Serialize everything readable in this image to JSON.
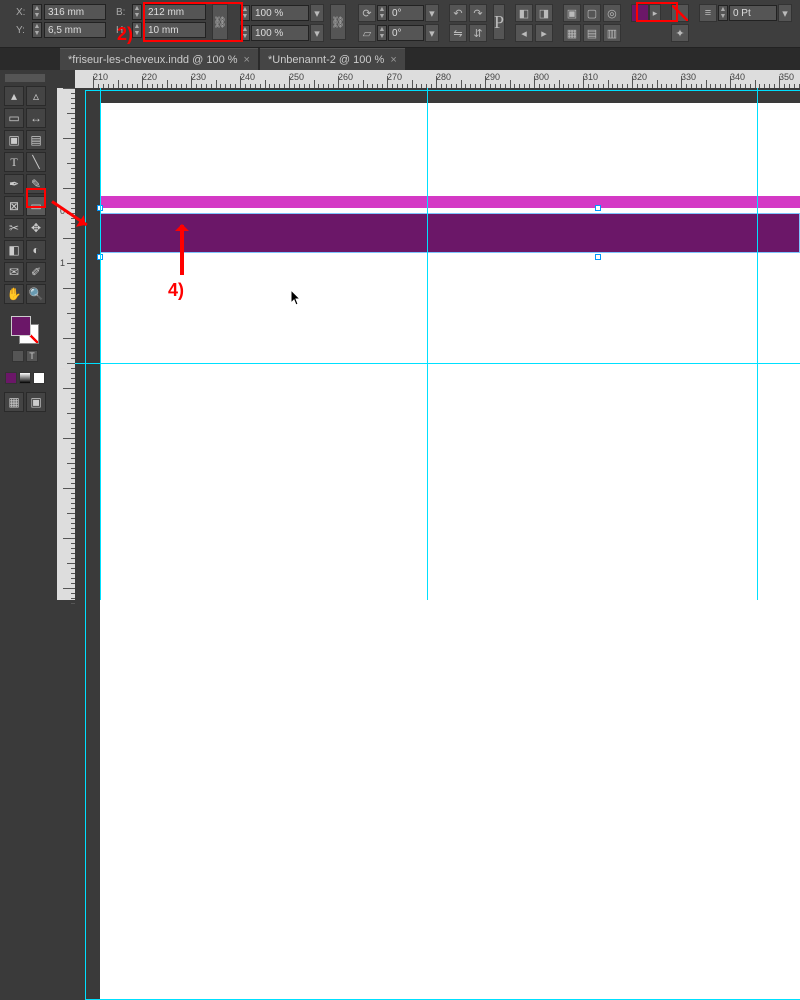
{
  "controlbar": {
    "x_label": "X:",
    "x_value": "316 mm",
    "y_label": "Y:",
    "y_value": "6,5 mm",
    "w_label": "B:",
    "w_value": "212 mm",
    "h_label": "H:",
    "h_value": "10 mm",
    "scale_x": "100 %",
    "scale_y": "100 %",
    "rotate": "0°",
    "shear": "0°",
    "stroke_weight": "0 Pt",
    "fill_color": "#6b1768"
  },
  "tabs": [
    {
      "label": "*friseur-les-cheveux.indd @ 100 %"
    },
    {
      "label": "*Unbenannt-2 @ 100 %"
    }
  ],
  "ruler_h": [
    "210",
    "220",
    "230",
    "240",
    "250",
    "260",
    "270",
    "280",
    "290",
    "300",
    "310",
    "320",
    "330",
    "340",
    "350"
  ],
  "ruler_v": [
    "0",
    "1"
  ],
  "annotations": {
    "two": "2)",
    "four": "4)"
  },
  "tool_names": {
    "selection": "selection-tool",
    "direct": "direct-select-tool",
    "page": "page-tool",
    "gap": "gap-tool",
    "content": "content-collector-tool",
    "place": "content-placer-tool",
    "type": "type-tool",
    "line": "line-tool",
    "pen": "pen-tool",
    "pencil": "pencil-tool",
    "rect-frame": "rectangle-frame-tool",
    "rect": "rectangle-tool",
    "scissors": "scissors-tool",
    "transform": "free-transform-tool",
    "gradient-swatch": "gradient-swatch-tool",
    "gradient-feather": "gradient-feather-tool",
    "note": "note-tool",
    "eyedropper": "eyedropper-tool",
    "hand": "hand-tool",
    "zoom": "zoom-tool"
  }
}
